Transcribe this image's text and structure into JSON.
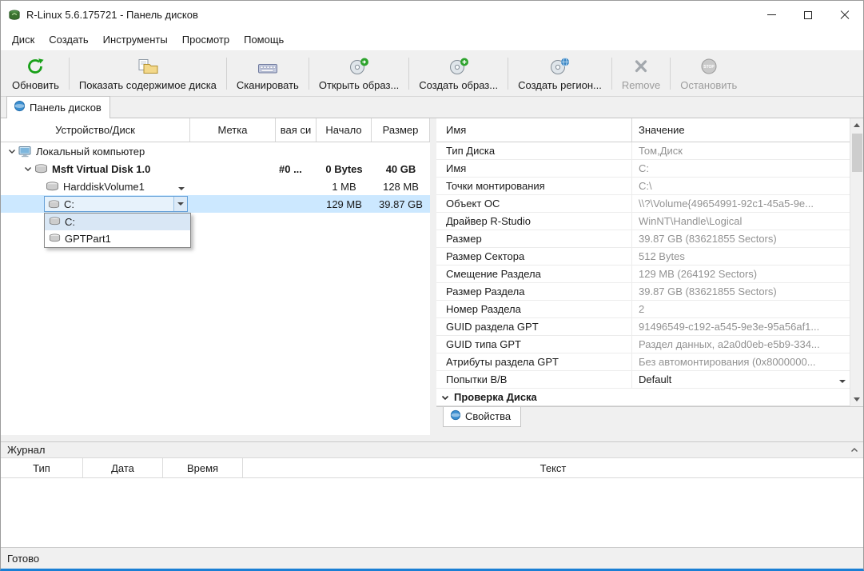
{
  "window": {
    "title": "R-Linux 5.6.175721 - Панель дисков"
  },
  "menu": {
    "items": [
      "Диск",
      "Создать",
      "Инструменты",
      "Просмотр",
      "Помощь"
    ]
  },
  "toolbar": {
    "buttons": [
      {
        "label": "Обновить",
        "enabled": true
      },
      {
        "label": "Показать содержимое диска",
        "enabled": true
      },
      {
        "label": "Сканировать",
        "enabled": true
      },
      {
        "label": "Открыть образ...",
        "enabled": true
      },
      {
        "label": "Создать образ...",
        "enabled": true
      },
      {
        "label": "Создать регион...",
        "enabled": true
      },
      {
        "label": "Remove",
        "enabled": false
      },
      {
        "label": "Остановить",
        "enabled": false
      }
    ]
  },
  "tabs": {
    "active": "Панель дисков"
  },
  "disk_tree": {
    "columns": [
      "Устройство/Диск",
      "Метка",
      "вая си",
      "Начало",
      "Размер"
    ],
    "rows": [
      {
        "name": "Локальный компьютер",
        "metka": "",
        "fs": "",
        "start": "",
        "size": ""
      },
      {
        "name": "Msft Virtual Disk 1.0",
        "metka": "",
        "fs": "#0 ...",
        "start": "0 Bytes",
        "size": "40 GB"
      },
      {
        "name": "HarddiskVolume1",
        "metka": "",
        "fs": "",
        "start": "1 MB",
        "size": "128 MB"
      },
      {
        "name": "C:",
        "metka": "",
        "fs": "",
        "start": "129 MB",
        "size": "39.87 GB"
      }
    ],
    "dropdown_items": [
      "C:",
      "GPTPart1"
    ]
  },
  "properties": {
    "columns": [
      "Имя",
      "Значение"
    ],
    "rows": [
      {
        "name": "Тип Диска",
        "value": "Том,Диск"
      },
      {
        "name": "Имя",
        "value": "C:"
      },
      {
        "name": "Точки монтирования",
        "value": "C:\\"
      },
      {
        "name": "Объект ОС",
        "value": "\\\\?\\Volume{49654991-92c1-45a5-9e..."
      },
      {
        "name": "Драйвер R-Studio",
        "value": "WinNT\\Handle\\Logical"
      },
      {
        "name": "Размер",
        "value": "39.87 GB (83621855 Sectors)"
      },
      {
        "name": "Размер Сектора",
        "value": "512 Bytes"
      },
      {
        "name": "Смещение Раздела",
        "value": "129 MB (264192 Sectors)"
      },
      {
        "name": "Размер Раздела",
        "value": "39.87 GB (83621855 Sectors)"
      },
      {
        "name": "Номер Раздела",
        "value": "2"
      },
      {
        "name": "GUID раздела GPT",
        "value": "91496549-c192-a545-9e3e-95a56af1..."
      },
      {
        "name": "GUID типа GPT",
        "value": "Раздел данных, a2a0d0eb-e5b9-334..."
      },
      {
        "name": "Атрибуты раздела GPT",
        "value": "Без автомонтирования (0x8000000..."
      },
      {
        "name": "Попытки В/В",
        "value": "Default"
      },
      {
        "name": "Проверка Диска",
        "value": ""
      }
    ],
    "tab_label": "Свойства"
  },
  "log": {
    "title": "Журнал",
    "columns": [
      "Тип",
      "Дата",
      "Время",
      "Текст"
    ]
  },
  "status": {
    "text": "Готово"
  }
}
